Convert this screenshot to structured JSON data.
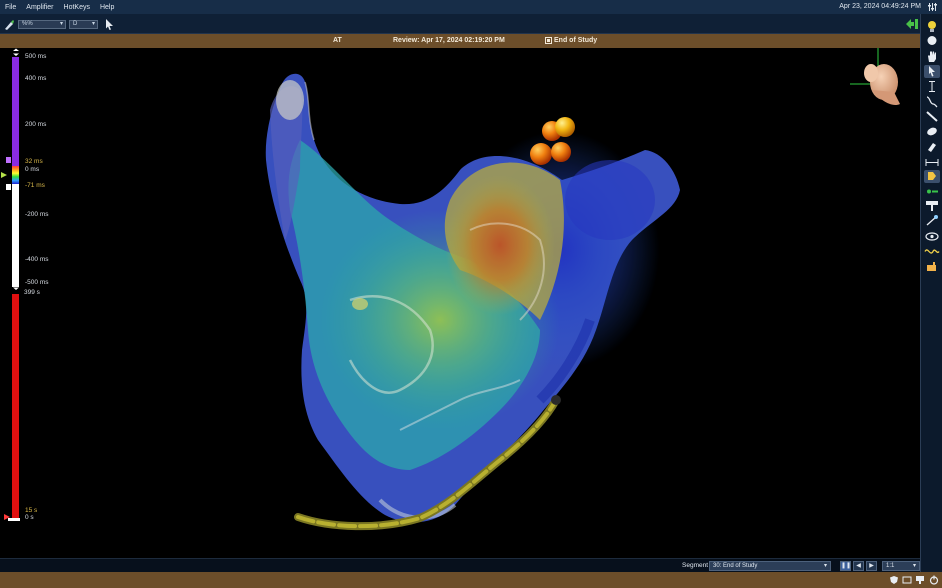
{
  "menu": {
    "items": [
      "File",
      "Amplifier",
      "HotKeys",
      "Help"
    ],
    "clock": "Apr 23, 2024 04:49:24 PM"
  },
  "toolbar": {
    "view_combo": "%%",
    "letter_combo": "D"
  },
  "infobar": {
    "map_name": "AT",
    "review": "Review: Apr 17, 2024 02:19:20 PM",
    "segment": "End of Study"
  },
  "scale": {
    "labels": [
      "500 ms",
      "400 ms",
      "200 ms",
      "32 ms",
      "0 ms",
      "-71 ms",
      "-200 ms",
      "-400 ms",
      "-500 ms",
      "399 s",
      "15 s",
      "0 s"
    ],
    "upper_threshold_ms": 32,
    "lower_threshold_ms": -71
  },
  "segment_bar": {
    "label": "Segment",
    "selected": "30: End of Study",
    "speed": "1:1"
  },
  "colors": {
    "menubar": "#172d48",
    "infobar": "#6c4e2a",
    "scale_purple": "#8a2be2",
    "scale_red": "#e01010",
    "statusbar": "#6c4e2a"
  },
  "icons": {
    "toolbar": [
      "pen-icon",
      "arrow-pointer-icon"
    ],
    "right_toolbar": [
      "light-bulb-icon",
      "sphere-icon",
      "hand-icon",
      "pointer-icon",
      "caliper-icon",
      "curve-icon",
      "line-icon",
      "ellipse-icon",
      "eraser-icon",
      "width-icon",
      "tag-icon",
      "catheter-icon",
      "projection-icon",
      "vector-icon",
      "eye-icon",
      "wave-icon",
      "hand-pointer-icon"
    ],
    "status": [
      "shield-icon",
      "monitor-icon",
      "display-icon",
      "power-icon"
    ]
  }
}
